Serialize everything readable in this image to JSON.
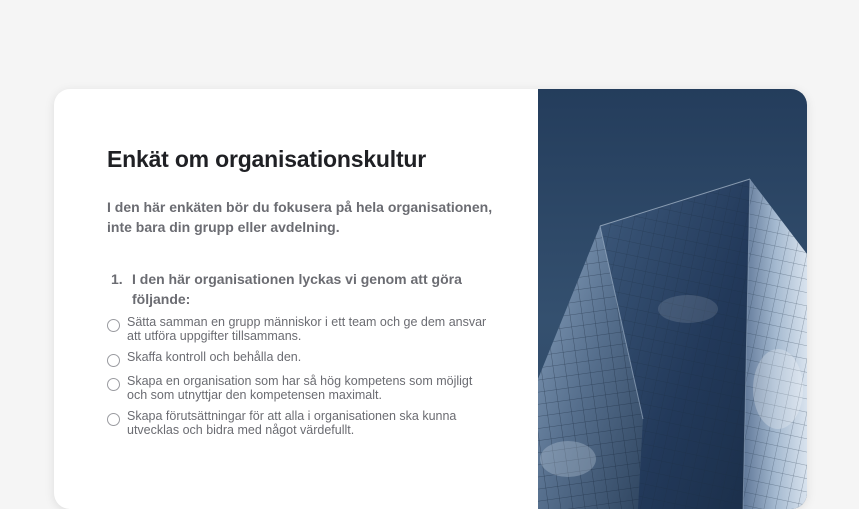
{
  "survey": {
    "title": "Enkät om organisationskultur",
    "intro": "I den här enkäten bör du fokusera på hela organisationen, inte bara din grupp eller avdelning.",
    "question": {
      "number": "1.",
      "text": "I den här organisationen lyckas vi genom att göra följande:",
      "options": [
        "Sätta samman en grupp människor i ett team och ge dem ansvar att utföra uppgifter tillsammans.",
        "Skaffa kontroll och behålla den.",
        "Skapa en organisation som har så hög kompetens som möjligt och som utnyttjar den kompetensen maximalt.",
        "Skapa förutsättningar för att alla i organisationen ska kunna utvecklas och bidra med något värdefullt."
      ]
    }
  },
  "colors": {
    "background": "#f5f5f5",
    "card": "#ffffff",
    "title": "#1f2024",
    "body_text": "#6b6c72",
    "sky": "#2f4a6b"
  }
}
